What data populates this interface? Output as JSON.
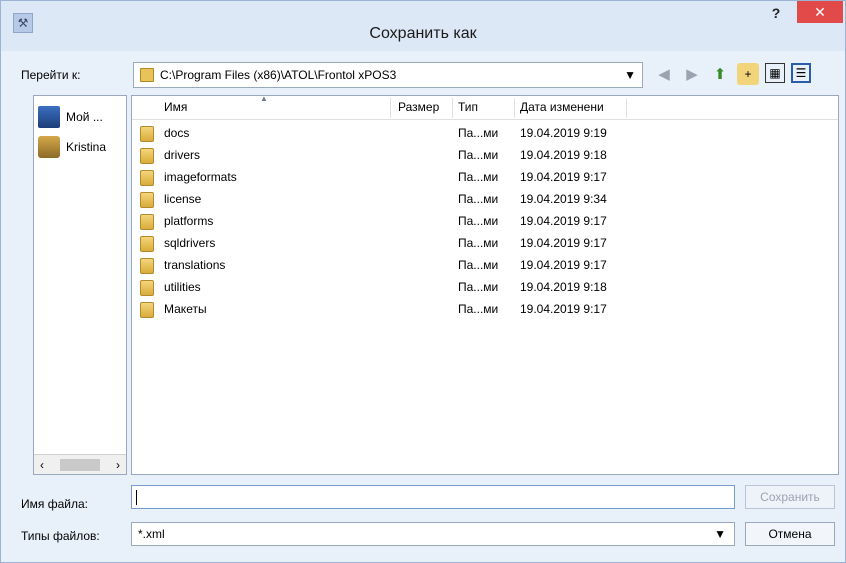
{
  "window": {
    "title": "Сохранить как",
    "help_glyph": "?",
    "close_glyph": "✕"
  },
  "navigation": {
    "label": "Перейти к:",
    "path": "C:\\Program Files (x86)\\ATOL\\Frontol xPOS3",
    "icons": [
      "back-icon",
      "forward-icon",
      "up-icon",
      "new-folder-icon",
      "icon-view-icon",
      "detail-view-icon"
    ]
  },
  "sidebar": {
    "items": [
      {
        "label": "Мой ...",
        "icon": "computer-icon"
      },
      {
        "label": "Kristina",
        "icon": "user-folder-icon"
      }
    ]
  },
  "file_list": {
    "columns": [
      "Имя",
      "Размер",
      "Тип",
      "Дата изменени"
    ],
    "rows": [
      {
        "name": "docs",
        "size": "",
        "type": "Па...ми",
        "date": "19.04.2019 9:19"
      },
      {
        "name": "drivers",
        "size": "",
        "type": "Па...ми",
        "date": "19.04.2019 9:18"
      },
      {
        "name": "imageformats",
        "size": "",
        "type": "Па...ми",
        "date": "19.04.2019 9:17"
      },
      {
        "name": "license",
        "size": "",
        "type": "Па...ми",
        "date": "19.04.2019 9:34"
      },
      {
        "name": "platforms",
        "size": "",
        "type": "Па...ми",
        "date": "19.04.2019 9:17"
      },
      {
        "name": "sqldrivers",
        "size": "",
        "type": "Па...ми",
        "date": "19.04.2019 9:17"
      },
      {
        "name": "translations",
        "size": "",
        "type": "Па...ми",
        "date": "19.04.2019 9:17"
      },
      {
        "name": "utilities",
        "size": "",
        "type": "Па...ми",
        "date": "19.04.2019 9:18"
      },
      {
        "name": "Макеты",
        "size": "",
        "type": "Па...ми",
        "date": "19.04.2019 9:17"
      }
    ]
  },
  "filename": {
    "label": "Имя файла:",
    "value": ""
  },
  "filetype": {
    "label": "Типы файлов:",
    "value": "*.xml"
  },
  "buttons": {
    "save": "Сохранить",
    "cancel": "Отмена"
  }
}
